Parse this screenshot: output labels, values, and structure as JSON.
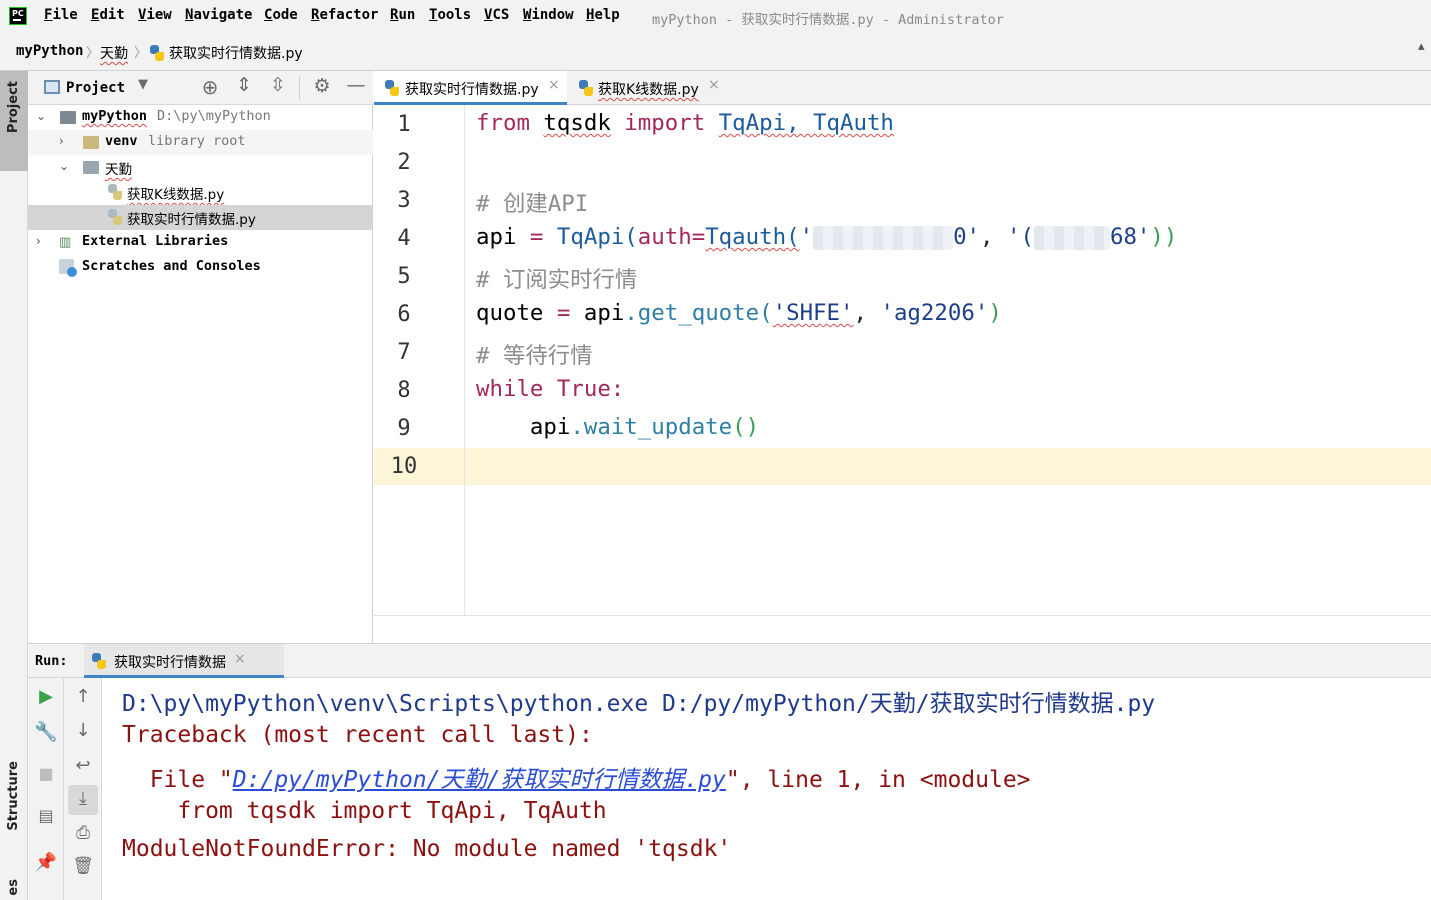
{
  "menu": {
    "items": [
      "File",
      "Edit",
      "View",
      "Navigate",
      "Code",
      "Refactor",
      "Run",
      "Tools",
      "VCS",
      "Window",
      "Help"
    ],
    "window_title": "myPython - 获取实时行情数据.py - Administrator",
    "logo_text": "PC"
  },
  "breadcrumb": [
    "myPython",
    "天勤",
    "获取实时行情数据.py"
  ],
  "left_stripe": {
    "project_label": "Project",
    "structure_label": "Structure",
    "bottom_label": "es"
  },
  "project_panel": {
    "title": "Project",
    "tree": [
      {
        "label": "myPython",
        "hint": "D:\\py\\myPython"
      },
      {
        "label": "venv",
        "hint": "library root"
      },
      {
        "label": "天勤",
        "hint": ""
      },
      {
        "label": "获取K线数据.py",
        "hint": ""
      },
      {
        "label": "获取实时行情数据.py",
        "hint": ""
      },
      {
        "label": "External Libraries",
        "hint": ""
      },
      {
        "label": "Scratches and Consoles",
        "hint": ""
      }
    ]
  },
  "editor_tabs": [
    {
      "label": "获取实时行情数据.py",
      "active": true
    },
    {
      "label": "获取K线数据.py",
      "active": false
    }
  ],
  "editor": {
    "line_numbers": [
      "1",
      "2",
      "3",
      "4",
      "5",
      "6",
      "7",
      "8",
      "9",
      "10"
    ],
    "current_line": 10,
    "code": {
      "l1": {
        "from": "from",
        "mod": "tqsdk",
        "import": "import",
        "names": "TqApi, TqAuth"
      },
      "l3": "# 创建API",
      "l4": {
        "var": "api",
        "eq": " = ",
        "call": "TqApi(",
        "kw": "auth=",
        "fn": "Tqauth(",
        "s1_end": "0'",
        "s2_start": "'(",
        "s2_end": "68'",
        "close": "))",
        "sep": ", "
      },
      "l5": "# 订阅实时行情",
      "l6": {
        "var": "quote",
        "eq": " = ",
        "obj": "api",
        "method": ".get_quote(",
        "arg1": "'SHFE'",
        "sep": ", ",
        "arg2": "'ag2206'",
        "close": ")"
      },
      "l7": "# 等待行情",
      "l8": {
        "kw": "while",
        "val": "True:"
      },
      "l9": {
        "obj": "api",
        "method": ".wait_update",
        "call": "()"
      }
    }
  },
  "run_panel": {
    "label": "Run:",
    "tab_label": "获取实时行情数据",
    "console": {
      "line1": "D:\\py\\myPython\\venv\\Scripts\\python.exe D:/py/myPython/天勤/获取实时行情数据.py",
      "line2": "Traceback (most recent call last):",
      "line3_prefix": "  File \"",
      "line3_link": "D:/py/myPython/天勤/获取实时行情数据.py",
      "line3_suffix": "\", line 1, in <module>",
      "line4": "    from tqsdk import TqApi, TqAuth",
      "line5": "ModuleNotFoundError: No module named 'tqsdk'"
    }
  },
  "icons": {
    "run": "run-icon",
    "wrench": "wrench-icon",
    "stop": "stop-icon",
    "layout": "layout-icon",
    "pin": "pin-icon",
    "up": "arrow-up-icon",
    "down": "arrow-down-icon",
    "wrap": "soft-wrap-icon",
    "scroll": "scroll-to-end-icon",
    "print": "print-icon",
    "trash": "trash-icon",
    "gear": "gear-icon",
    "target": "locate-icon"
  },
  "colors": {
    "accent": "#4083c9",
    "keyword": "#a4285c",
    "error": "#8b1010",
    "link": "#2a4cd6",
    "current_line": "#fcf5d8"
  }
}
